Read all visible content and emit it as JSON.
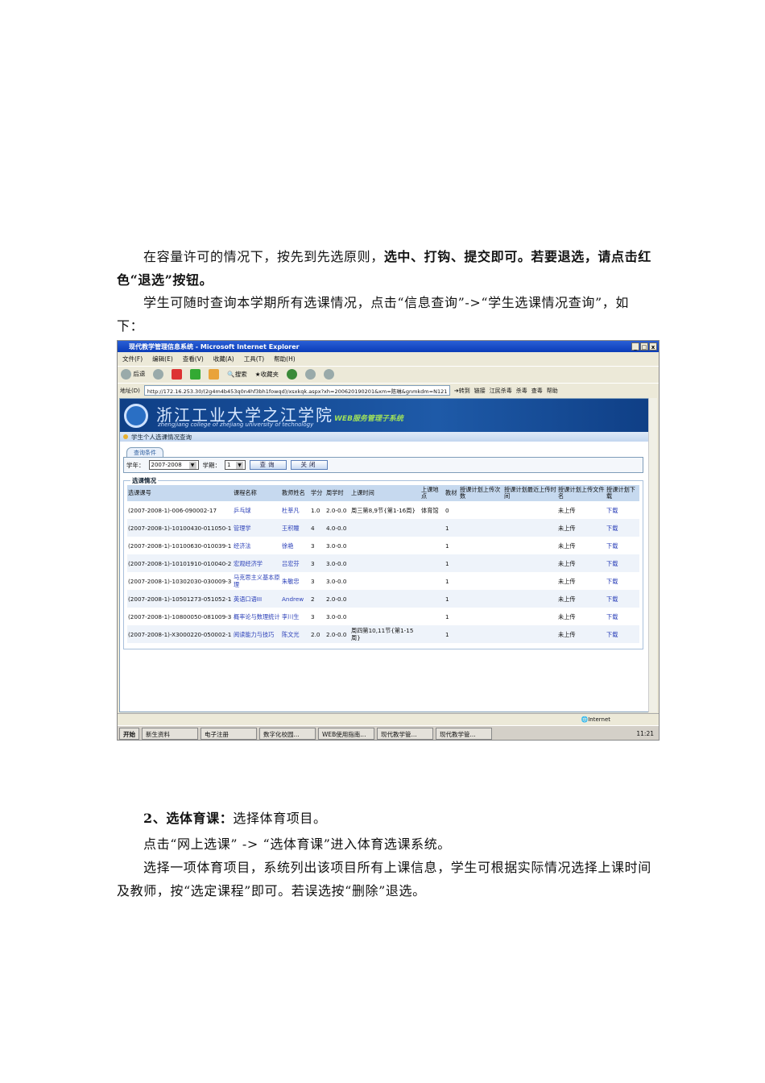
{
  "paragraphs": {
    "p1_normal": "在容量许可的情况下，按先到先选原则，",
    "p1_bold": "选中、打钩、提交即可。若要退选，请点击红色“退选”按钮。",
    "p2": "学生可随时查询本学期所有选课情况，点击“信息查询”->“学生选课情况查询”，如下：",
    "p3_bold": "2、选体育课：",
    "p3_normal": "选择体育项目。",
    "p4": "点击“网上选课” -> “选体育课”进入体育选课系统。",
    "p5": "选择一项体育项目，系统列出该项目所有上课信息，学生可根据实际情况选择上课时间及教师，按“选定课程”即可。若误选按“删除”退选。"
  },
  "browser": {
    "title": "现代教学管理信息系统 - Microsoft Internet Explorer",
    "menu": [
      "文件(F)",
      "编辑(E)",
      "查看(V)",
      "收藏(A)",
      "工具(T)",
      "帮助(H)"
    ],
    "toolbar": [
      "后退",
      "搜索",
      "收藏夹"
    ],
    "address_label": "地址(D)",
    "url": "http://172.16.253.30/(2g4m4b453q0n4hf3bh1fowqd)/xsxkqk.aspx?xh=200620190201&xm=陈琳&gnmkdm=N121",
    "go": "转到",
    "links": [
      "链接",
      "江民杀毒",
      "杀毒",
      "查毒",
      "帮助"
    ],
    "status": "Internet"
  },
  "banner": {
    "school": "浙江工业大学之江学院",
    "school_en": "zhengjiang college of zhejiang university of technology",
    "subsystem": "WEB服务管理子系统"
  },
  "page": {
    "section": "学生个人选课情况查询",
    "query_tab": "查询条件",
    "year_label": "学年：",
    "year_value": "2007-2008",
    "term_label": "学期：",
    "term_value": "1",
    "query_btn": "查询",
    "close_btn": "关闭",
    "results_legend": "选课情况",
    "columns": [
      "选课课号",
      "课程名称",
      "教师姓名",
      "学分",
      "周学时",
      "上课时间",
      "上课地点",
      "教材",
      "授课计划上传次数",
      "授课计划最近上传时间",
      "授课计划上传文件名",
      "授课计划下载"
    ],
    "rows": [
      [
        "(2007-2008-1)-006-090002-17",
        "乒乓球",
        "杜莘凡",
        "1.0",
        "2.0-0.0",
        "周三第8,9节{第1-16周}",
        "体育馆",
        "0",
        "",
        "",
        "未上传",
        "下载"
      ],
      [
        "(2007-2008-1)-10100430-011050-1",
        "管理学",
        "王积瞳",
        "4",
        "4.0-0.0",
        "",
        "",
        "1",
        "",
        "",
        "未上传",
        "下载"
      ],
      [
        "(2007-2008-1)-10100630-010039-1",
        "经济法",
        "徐艳",
        "3",
        "3.0-0.0",
        "",
        "",
        "1",
        "",
        "",
        "未上传",
        "下载"
      ],
      [
        "(2007-2008-1)-10101910-010040-2",
        "宏观经济学",
        "吕宏芬",
        "3",
        "3.0-0.0",
        "",
        "",
        "1",
        "",
        "",
        "未上传",
        "下载"
      ],
      [
        "(2007-2008-1)-10302030-030009-3",
        "马克思主义基本原理",
        "朱敏忠",
        "3",
        "3.0-0.0",
        "",
        "",
        "1",
        "",
        "",
        "未上传",
        "下载"
      ],
      [
        "(2007-2008-1)-10501273-051052-1",
        "英语口语III",
        "Andrew",
        "2",
        "2.0-0.0",
        "",
        "",
        "1",
        "",
        "",
        "未上传",
        "下载"
      ],
      [
        "(2007-2008-1)-10800050-081009-3",
        "概率论与数理统计",
        "李川生",
        "3",
        "3.0-0.0",
        "",
        "",
        "1",
        "",
        "",
        "未上传",
        "下载"
      ],
      [
        "(2007-2008-1)-X3000220-050002-1",
        "阅读能力与技巧",
        "陈文光",
        "2.0",
        "2.0-0.0",
        "周四第10,11节{第1-15周}",
        "",
        "1",
        "",
        "",
        "未上传",
        "下载"
      ]
    ]
  },
  "taskbar": {
    "start": "开始",
    "tasks": [
      "新生资料",
      "电子注册",
      "数字化校园...",
      "WEB使用指南...",
      "现代教学管...",
      "现代教学管..."
    ],
    "clock": "11:21"
  }
}
